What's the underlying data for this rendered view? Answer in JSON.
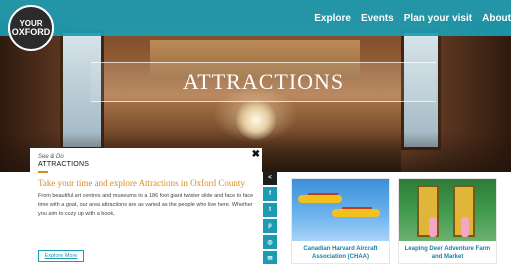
{
  "header": {
    "logo_line1": "YOUR",
    "logo_line2": "OXFORD",
    "nav": [
      "Explore",
      "Events",
      "Plan your visit",
      "About"
    ]
  },
  "hero": {
    "title": "ATTRACTIONS"
  },
  "panel": {
    "kicker": "See & Do",
    "section": "ATTRACTIONS",
    "close": "✖",
    "headline": "Take your time and explore Attractions in Oxford County",
    "body": "From beautiful art centres and museums to a 186 foot giant twister slide and face to face time with a goat, our area attractions are as varied as the people who live here.  Whether you aim to cozy up with a book,",
    "button": "Explore More"
  },
  "social": {
    "icons": [
      "share-icon",
      "facebook-icon",
      "twitter-icon",
      "pinterest-icon",
      "instagram-icon",
      "email-icon"
    ],
    "glyphs": [
      "<",
      "f",
      "t",
      "p",
      "◎",
      "✉"
    ]
  },
  "cards": [
    {
      "caption": "Canadian Harvard Aircraft Association (CHAA)"
    },
    {
      "caption": "Leaping Deer Adventure Farm and Market"
    }
  ],
  "colors": {
    "accent": "#1c9cb2",
    "orange": "#e08a1e"
  }
}
